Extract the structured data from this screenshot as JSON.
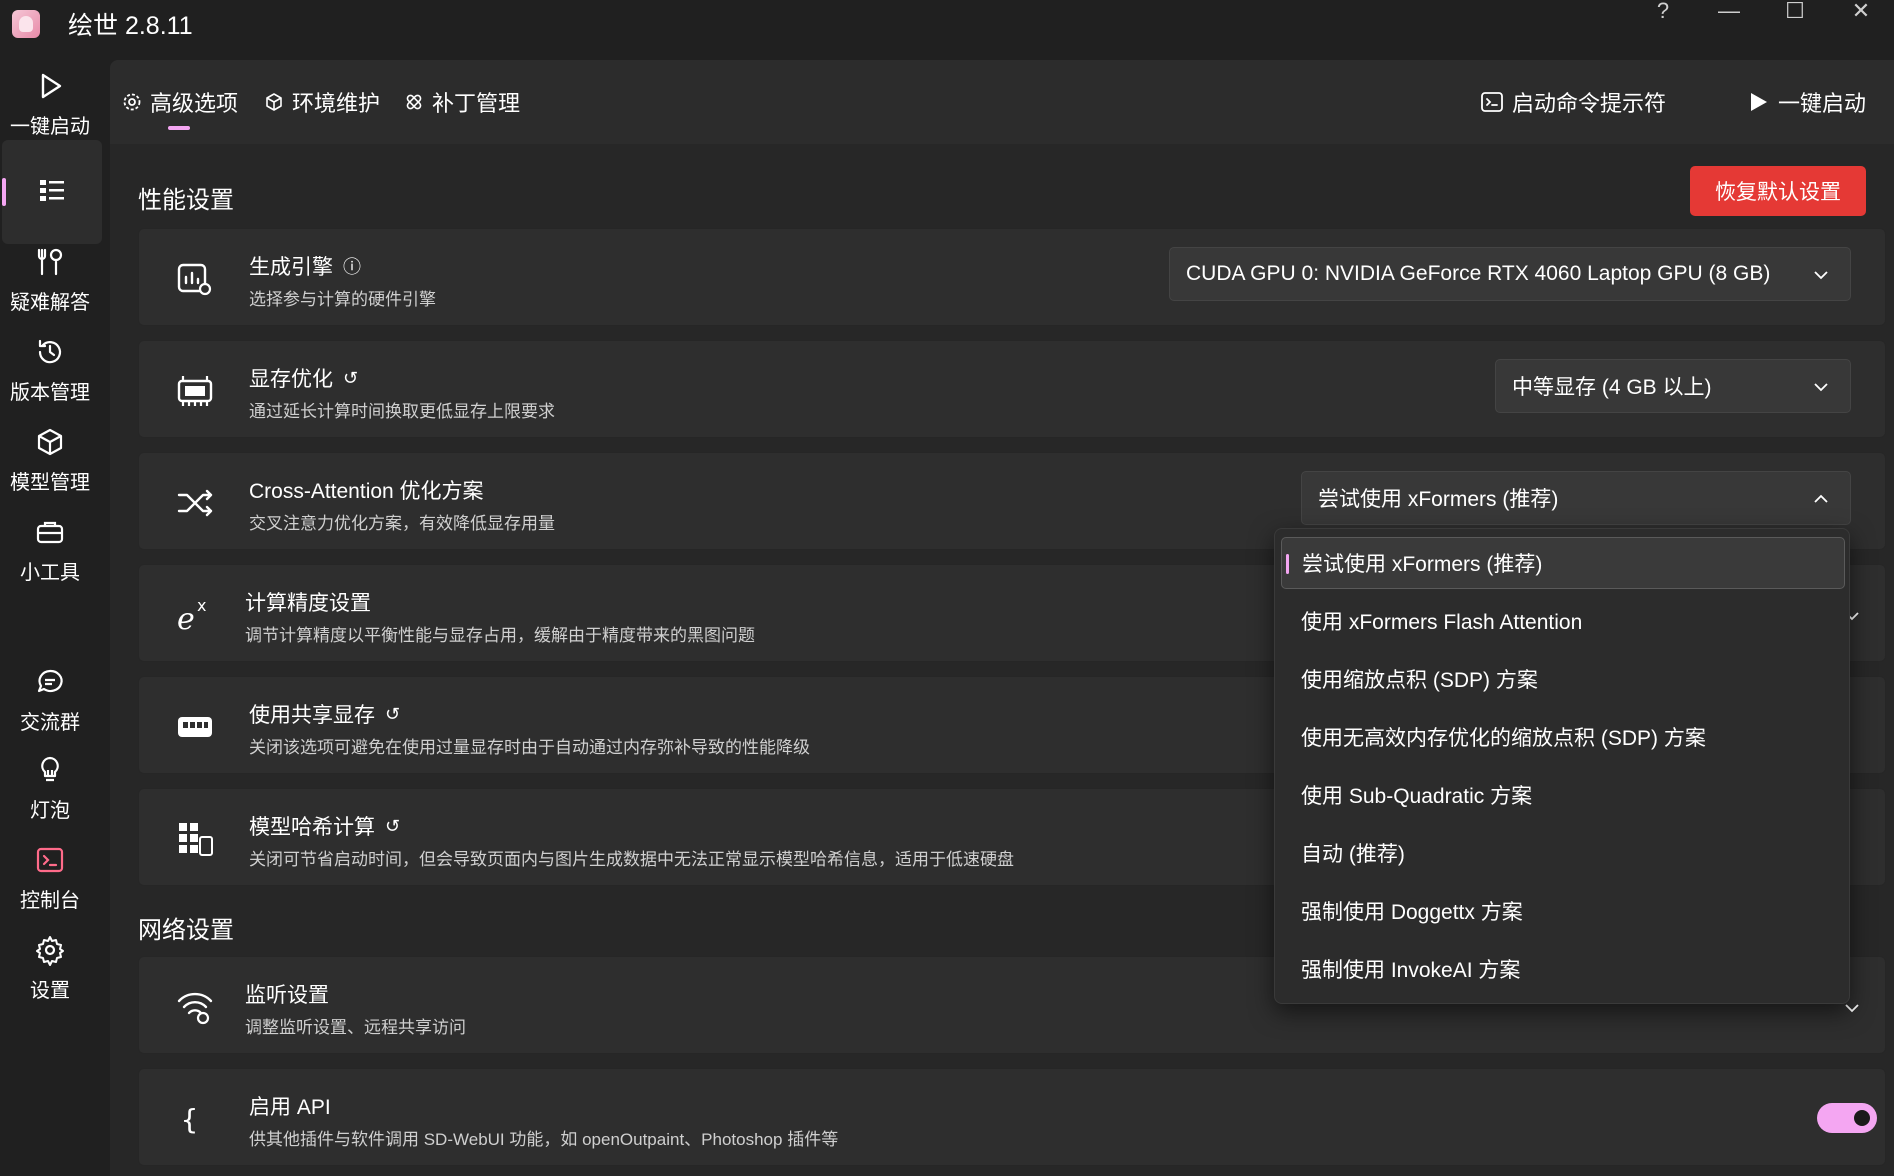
{
  "app": {
    "title": "绘世 2.8.11"
  },
  "window_controls": {
    "help": "?",
    "minimize": "—",
    "maximize": "☐",
    "close": "✕"
  },
  "nav": {
    "items": [
      {
        "label": "一键启动",
        "icon": "play-icon"
      },
      {
        "label": "",
        "icon": "list-icon",
        "active": true
      },
      {
        "label": "疑难解答",
        "icon": "tools-icon"
      },
      {
        "label": "版本管理",
        "icon": "history-icon"
      },
      {
        "label": "模型管理",
        "icon": "cube-icon"
      },
      {
        "label": "小工具",
        "icon": "toolbox-icon"
      },
      {
        "label": "交流群",
        "icon": "chat-icon"
      },
      {
        "label": "灯泡",
        "icon": "bulb-icon"
      },
      {
        "label": "控制台",
        "icon": "console-icon"
      },
      {
        "label": "设置",
        "icon": "gear-icon"
      }
    ]
  },
  "tabs": [
    {
      "label": "高级选项",
      "icon": "gear-icon",
      "active": true
    },
    {
      "label": "环境维护",
      "icon": "package-icon"
    },
    {
      "label": "补丁管理",
      "icon": "bandage-icon"
    }
  ],
  "toolbar": {
    "command_prompt": "启动命令提示符",
    "launch": "一键启动"
  },
  "performance": {
    "section_title": "性能设置",
    "reset_button": "恢复默认设置",
    "cards": [
      {
        "title": "生成引擎",
        "desc": "选择参与计算的硬件引擎",
        "value": "CUDA GPU 0: NVIDIA GeForce RTX 4060 Laptop GPU (8 GB)"
      },
      {
        "title": "显存优化",
        "desc": "通过延长计算时间换取更低显存上限要求",
        "value": "中等显存 (4 GB 以上)"
      },
      {
        "title": "Cross-Attention 优化方案",
        "desc": "交叉注意力优化方案，有效降低显存用量",
        "value": "尝试使用 xFormers (推荐)"
      },
      {
        "title": "计算精度设置",
        "desc": "调节计算精度以平衡性能与显存占用，缓解由于精度带来的黑图问题"
      },
      {
        "title": "使用共享显存",
        "desc": "关闭该选项可避免在使用过量显存时由于自动通过内存弥补导致的性能降级"
      },
      {
        "title": "模型哈希计算",
        "desc": "关闭可节省启动时间，但会导致页面内与图片生成数据中无法正常显示模型哈希信息，适用于低速硬盘"
      }
    ]
  },
  "network": {
    "section_title": "网络设置",
    "cards": [
      {
        "title": "监听设置",
        "desc": "调整监听设置、远程共享访问"
      },
      {
        "title": "启用 API",
        "desc": "供其他插件与软件调用 SD-WebUI 功能，如 openOutpaint、Photoshop 插件等",
        "toggle": true
      }
    ]
  },
  "dropdown": {
    "options": [
      "尝试使用 xFormers (推荐)",
      "使用 xFormers Flash Attention",
      "使用缩放点积 (SDP) 方案",
      "使用无高效内存优化的缩放点积 (SDP) 方案",
      "使用 Sub-Quadratic 方案",
      "自动 (推荐)",
      "强制使用 Doggettx 方案",
      "强制使用 InvokeAI 方案"
    ],
    "selected_index": 0
  },
  "colors": {
    "accent": "#f4a6f2",
    "danger": "#e53935",
    "background": "#202020",
    "card": "#2e2e2e"
  }
}
